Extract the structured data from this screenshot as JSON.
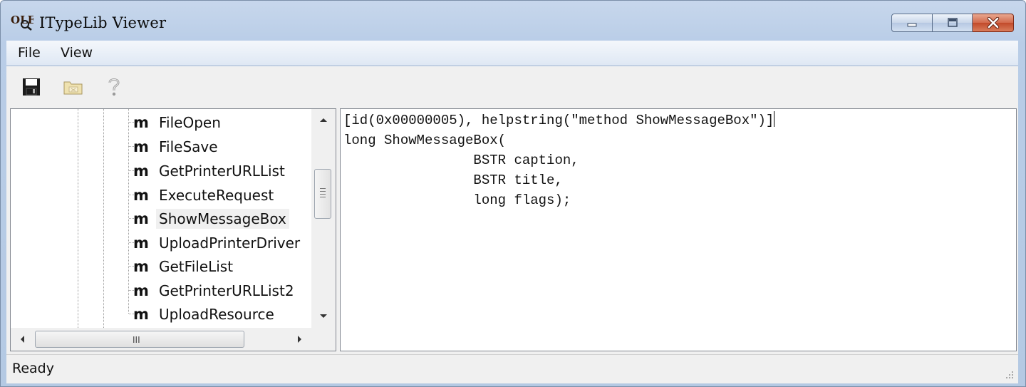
{
  "window": {
    "title": "ITypeLib Viewer",
    "caption_buttons": [
      "minimize-icon",
      "maximize-icon",
      "close-icon"
    ]
  },
  "menu": {
    "items": [
      {
        "label": "File"
      },
      {
        "label": "View"
      }
    ]
  },
  "toolbar": {
    "buttons": [
      {
        "icon": "floppy-save-icon"
      },
      {
        "icon": "folder-open-icon"
      },
      {
        "icon": "help-question-icon"
      }
    ]
  },
  "tree": {
    "method_glyph": "m",
    "items": [
      {
        "label": "FileOpen"
      },
      {
        "label": "FileSave"
      },
      {
        "label": "GetPrinterURLList"
      },
      {
        "label": "ExecuteRequest"
      },
      {
        "label": "ShowMessageBox",
        "selected": true
      },
      {
        "label": "UploadPrinterDriver"
      },
      {
        "label": "GetFileList"
      },
      {
        "label": "GetPrinterURLList2"
      },
      {
        "label": "UploadResource"
      }
    ],
    "hscroll_grip": "III"
  },
  "code": {
    "lines": [
      "[id(0x00000005), helpstring(\"method ShowMessageBox\")]",
      "long ShowMessageBox(",
      "                BSTR caption,",
      "                BSTR title,",
      "                long flags);"
    ]
  },
  "status": {
    "text": "Ready"
  },
  "colors": {
    "frame": "#b9cde7",
    "close_button": "#c24a2a",
    "pane_border": "#828790"
  }
}
